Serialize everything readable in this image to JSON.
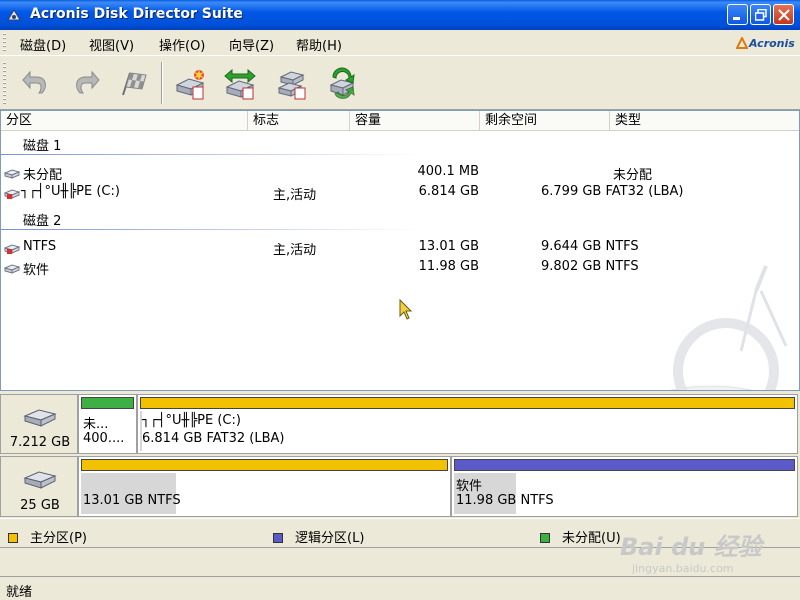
{
  "window": {
    "title": "Acronis Disk Director Suite"
  },
  "menu": {
    "items": [
      {
        "label": "磁盘(D)"
      },
      {
        "label": "视图(V)"
      },
      {
        "label": "操作(O)"
      },
      {
        "label": "向导(Z)"
      },
      {
        "label": "帮助(H)"
      }
    ],
    "brand": "Acronis"
  },
  "toolbar": {
    "buttons": [
      "undo-icon",
      "redo-icon",
      "commit-flag-icon",
      "create-partition-icon",
      "resize-partition-icon",
      "copy-partition-icon",
      "recovery-icon"
    ]
  },
  "partition_list": {
    "columns": [
      "分区",
      "标志",
      "容量",
      "剩余空间",
      "类型"
    ],
    "groups": [
      {
        "label": "磁盘 1",
        "rows": [
          {
            "name": "未分配",
            "flags": "",
            "capacity": "400.1 MB",
            "free": "",
            "type": "未分配"
          },
          {
            "name": "┐┌┤°U╫╠PE (C:)",
            "flags": "主,活动",
            "capacity": "6.814 GB",
            "free": "6.799 GB",
            "type": "FAT32 (LBA)"
          }
        ]
      },
      {
        "label": "磁盘 2",
        "rows": [
          {
            "name": "NTFS",
            "flags": "主,活动",
            "capacity": "13.01 GB",
            "free": "9.644 GB",
            "type": "NTFS"
          },
          {
            "name": "软件",
            "flags": "",
            "capacity": "11.98 GB",
            "free": "9.802 GB",
            "type": "NTFS"
          }
        ]
      }
    ]
  },
  "disk_map": {
    "disks": [
      {
        "size": "7.212 GB",
        "partitions": [
          {
            "line1": "未...",
            "line2": "400....",
            "bar_color": "#3cb043"
          },
          {
            "line1": "┐┌┤°U╫╠PE (C:)",
            "line2": "6.814 GB  FAT32 (LBA)",
            "bar_color": "#f2c200"
          }
        ]
      },
      {
        "size": "25 GB",
        "partitions": [
          {
            "line1": "",
            "line2": "13.01 GB  NTFS",
            "bar_color": "#f2c200",
            "used_fraction": 0.26
          },
          {
            "line1": "软件",
            "line2": "11.98 GB  NTFS",
            "bar_color": "#5a5ac8",
            "used_fraction": 0.18
          }
        ]
      }
    ]
  },
  "legend": [
    {
      "label": "主分区(P)",
      "color": "#f2c200"
    },
    {
      "label": "逻辑分区(L)",
      "color": "#5a5ac8"
    },
    {
      "label": "未分配(U)",
      "color": "#3cb043"
    }
  ],
  "status": {
    "text": "就绪"
  },
  "watermark": {
    "logo": "Bai du 经验",
    "url": "jingyan.baidu.com"
  }
}
